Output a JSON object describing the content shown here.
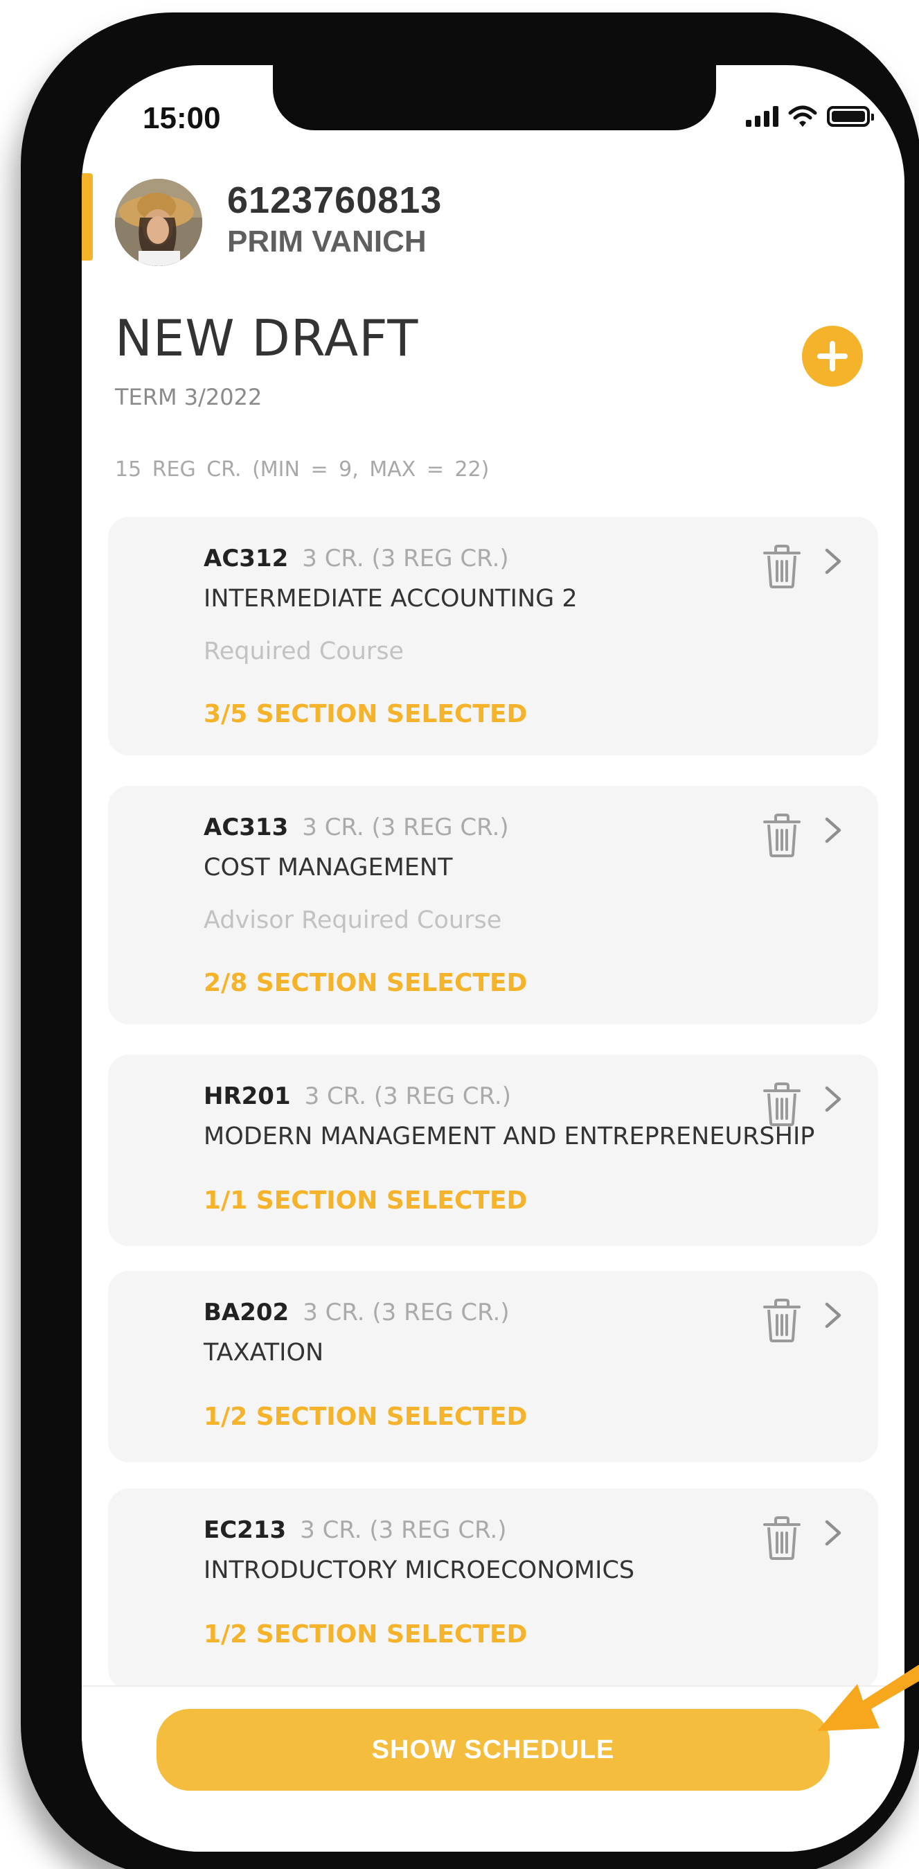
{
  "status_bar": {
    "time": "15:00",
    "icons": [
      "signal-icon",
      "wifi-icon",
      "battery-icon"
    ]
  },
  "profile": {
    "student_id": "6123760813",
    "name": "PRIM VANICH"
  },
  "draft": {
    "title": "NEW DRAFT",
    "term": "TERM 3/2022",
    "credit_summary": "15 REG CR. (MIN = 9, MAX = 22)"
  },
  "courses": [
    {
      "code": "AC312",
      "credits": "3 CR.  (3 REG CR.)",
      "title": "INTERMEDIATE ACCOUNTING 2",
      "type": "Required Course",
      "sections": "3/5 SECTION SELECTED"
    },
    {
      "code": "AC313",
      "credits": "3 CR.  (3 REG CR.)",
      "title": "COST MANAGEMENT",
      "type": "Advisor Required Course",
      "sections": "2/8 SECTION SELECTED"
    },
    {
      "code": "HR201",
      "credits": "3 CR.  (3 REG CR.)",
      "title": "MODERN MANAGEMENT AND ENTREPRENEURSHIP",
      "sections": "1/1 SECTION SELECTED"
    },
    {
      "code": "BA202",
      "credits": "3 CR.  (3 REG CR.)",
      "title": "TAXATION",
      "sections": "1/2 SECTION SELECTED"
    },
    {
      "code": "EC213",
      "credits": "3 CR.  (3 REG CR.)",
      "title": "INTRODUCTORY MICROECONOMICS",
      "sections": "1/2 SECTION SELECTED"
    }
  ],
  "actions": {
    "show_schedule": "SHOW SCHEDULE"
  },
  "colors": {
    "accent": "#f5b32c",
    "card_background": "#f5f5f5",
    "frame": "#0c0c0c"
  }
}
